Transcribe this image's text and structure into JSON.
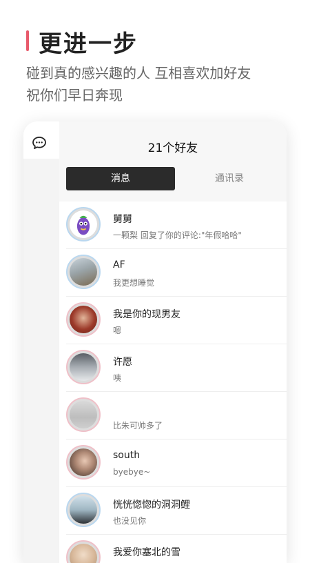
{
  "hero": {
    "title": "更进一步",
    "subtitle_line1": "碰到真的感兴趣的人 互相喜欢加好友",
    "subtitle_line2": "祝你们早日奔现"
  },
  "header": {
    "title": "21个好友",
    "tabs": [
      {
        "label": "消息",
        "active": true
      },
      {
        "label": "通讯录",
        "active": false
      }
    ]
  },
  "colors": {
    "accent": "#e85a6b",
    "tab_active_bg": "#2b2b2b"
  },
  "friends": [
    {
      "name": "舅舅",
      "message": "一颗梨 回复了你的评论:\"年假哈哈\""
    },
    {
      "name": "AF",
      "message": "我更想睡觉"
    },
    {
      "name": "我是你的现男友",
      "message": "嗯"
    },
    {
      "name": "许愿",
      "message": "咦"
    },
    {
      "name": "",
      "message": "比朱可帅多了"
    },
    {
      "name": "south",
      "message": "byebye~"
    },
    {
      "name": "恍恍惚惚的洞洞鲤",
      "message": "也没见你"
    },
    {
      "name": "我爱你塞北的雪",
      "message": ""
    }
  ]
}
